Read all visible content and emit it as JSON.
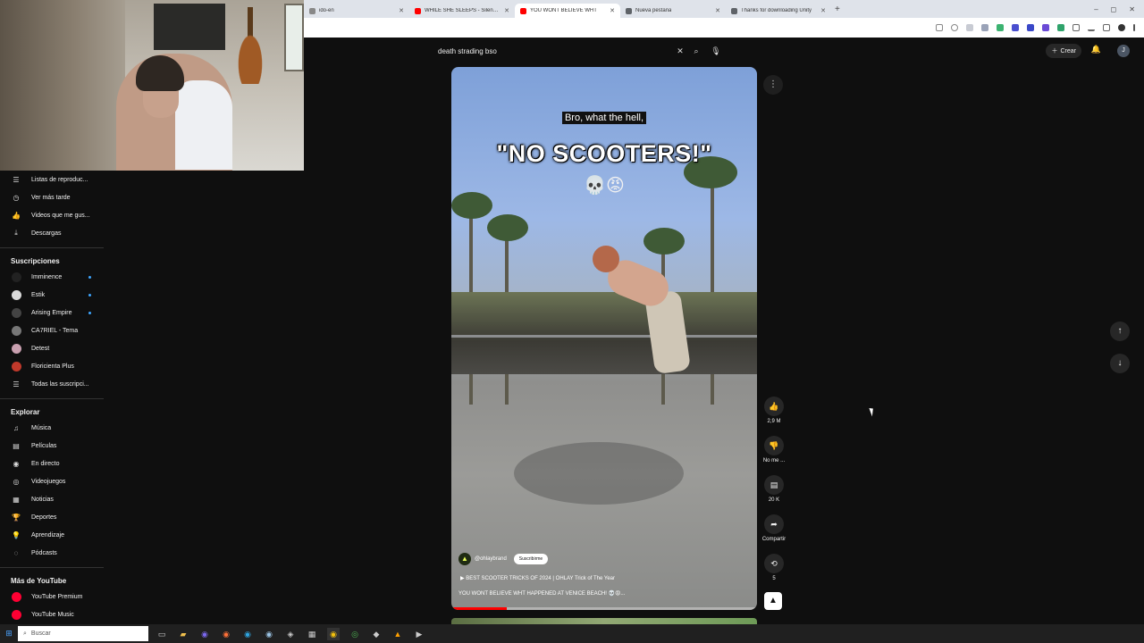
{
  "browser": {
    "tabs": [
      {
        "title": "ido-en",
        "color": "#888888"
      },
      {
        "title": "WHILE SHE SLEEPS - Silence Sp",
        "color": "#ff0000"
      },
      {
        "title": "YOU WONT BELIEVE WHT",
        "color": "#ff0000",
        "active": true
      },
      {
        "title": "Nueva pestaña",
        "color": "#5f6368"
      },
      {
        "title": "Thanks for downloading Unity",
        "color": "#5f6368"
      }
    ],
    "new_tab": "+",
    "window_controls": [
      "–",
      "◻",
      "✕"
    ]
  },
  "header": {
    "search_query": "death strading bso",
    "create_label": "Crear",
    "avatar_letter": "J"
  },
  "sidebar": {
    "you_items": [
      {
        "label": "Listas de reproduc...",
        "icon": "☰"
      },
      {
        "label": "Ver más tarde",
        "icon": "◷"
      },
      {
        "label": "Videos que me gus...",
        "icon": "👍"
      },
      {
        "label": "Descargas",
        "icon": "⤓"
      }
    ],
    "subs_title": "Suscripciones",
    "subscriptions": [
      {
        "label": "Imminence",
        "color": "#222222",
        "dot": true
      },
      {
        "label": "Estik",
        "color": "#d9d9d9",
        "dot": true
      },
      {
        "label": "Arising Empire",
        "color": "#444444",
        "dot": true
      },
      {
        "label": "CA7RIEL - Tema",
        "color": "#777777",
        "dot": false
      },
      {
        "label": "Detest",
        "color": "#c9a0b0",
        "dot": false
      },
      {
        "label": "Floricienta Plus",
        "color": "#c0392b",
        "dot": false
      },
      {
        "label": "Todas las suscripci...",
        "icon": "☰"
      }
    ],
    "explore_title": "Explorar",
    "explore": [
      {
        "label": "Música",
        "icon": "♫"
      },
      {
        "label": "Películas",
        "icon": "▤"
      },
      {
        "label": "En directo",
        "icon": "◉"
      },
      {
        "label": "Videojuegos",
        "icon": "◎"
      },
      {
        "label": "Noticias",
        "icon": "▦"
      },
      {
        "label": "Deportes",
        "icon": "🏆"
      },
      {
        "label": "Aprendizaje",
        "icon": "💡"
      },
      {
        "label": "Pódcasts",
        "icon": "◌"
      }
    ],
    "more_title": "Más de YouTube",
    "more": [
      {
        "label": "YouTube Premium",
        "color": "#ff0033"
      },
      {
        "label": "YouTube Music",
        "color": "#ff0033"
      }
    ]
  },
  "short": {
    "caption_small": "Bro, what the hell,",
    "caption_big": "\"NO SCOOTERS!\"",
    "caption_emoji": "💀😡",
    "channel": "@ohlaybrand",
    "subscribe": "Suscribirme",
    "playlist": "BEST SCOOTER TRICKS OF 2024 | OHLAY Trick of The Year",
    "title": "YOU WONT BELIEVE WHT HAPPENED AT VENICE BEACH! 💀😡...",
    "progress": 0.18
  },
  "actions": {
    "likes": "2,9 M",
    "dislike": "No me ...",
    "comments": "20 K",
    "share": "Compartir",
    "remix": "5"
  },
  "taskbar": {
    "search_placeholder": "Buscar"
  }
}
